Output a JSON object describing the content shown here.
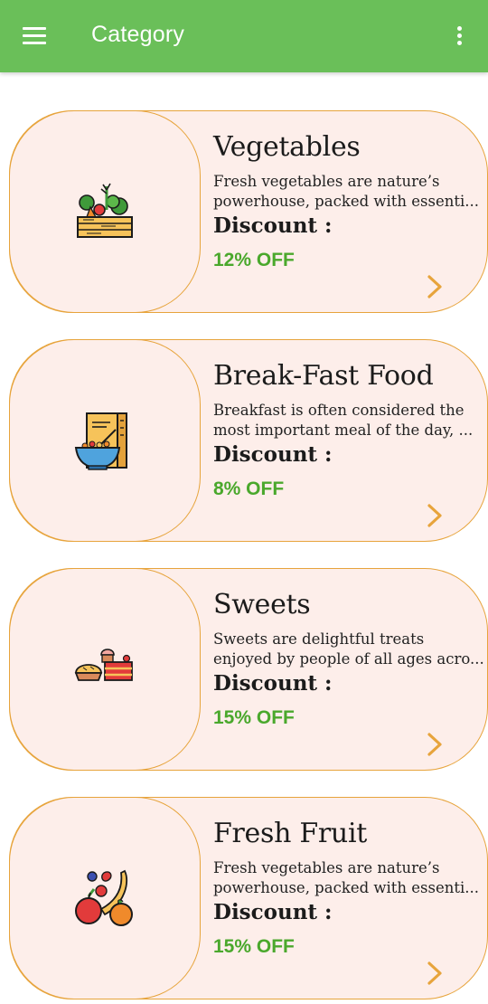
{
  "appbar": {
    "title": "Category",
    "menu_icon": "hamburger-menu-icon",
    "overflow_icon": "more-vert-icon",
    "color": "#6abf59"
  },
  "theme": {
    "card_background": "#fdeeea",
    "card_border": "#e7a43c",
    "discount_color": "#4aa82c",
    "chevron_color": "#e7a43c"
  },
  "categories": [
    {
      "title": "Vegetables",
      "desc_line1": "Fresh vegetables are nature’s",
      "desc_line2": "powerhouse, packed with essenti...",
      "discount_label": "Discount :",
      "discount_value": "12% OFF",
      "icon": "vegetable-crate-icon"
    },
    {
      "title": "Break-Fast Food",
      "desc_line1": "Breakfast is often considered the",
      "desc_line2": "most important meal of the day, ...",
      "discount_label": "Discount :",
      "discount_value": "8% OFF",
      "icon": "cereal-bowl-icon"
    },
    {
      "title": "Sweets",
      "desc_line1": "Sweets are delightful treats",
      "desc_line2": "enjoyed by people of all ages acro...",
      "discount_label": "Discount :",
      "discount_value": "15% OFF",
      "icon": "cake-pie-icon"
    },
    {
      "title": "Fresh Fruit",
      "desc_line1": "Fresh vegetables are nature’s",
      "desc_line2": "powerhouse, packed with essenti...",
      "discount_label": "Discount :",
      "discount_value": "15% OFF",
      "icon": "fruits-icon"
    }
  ]
}
